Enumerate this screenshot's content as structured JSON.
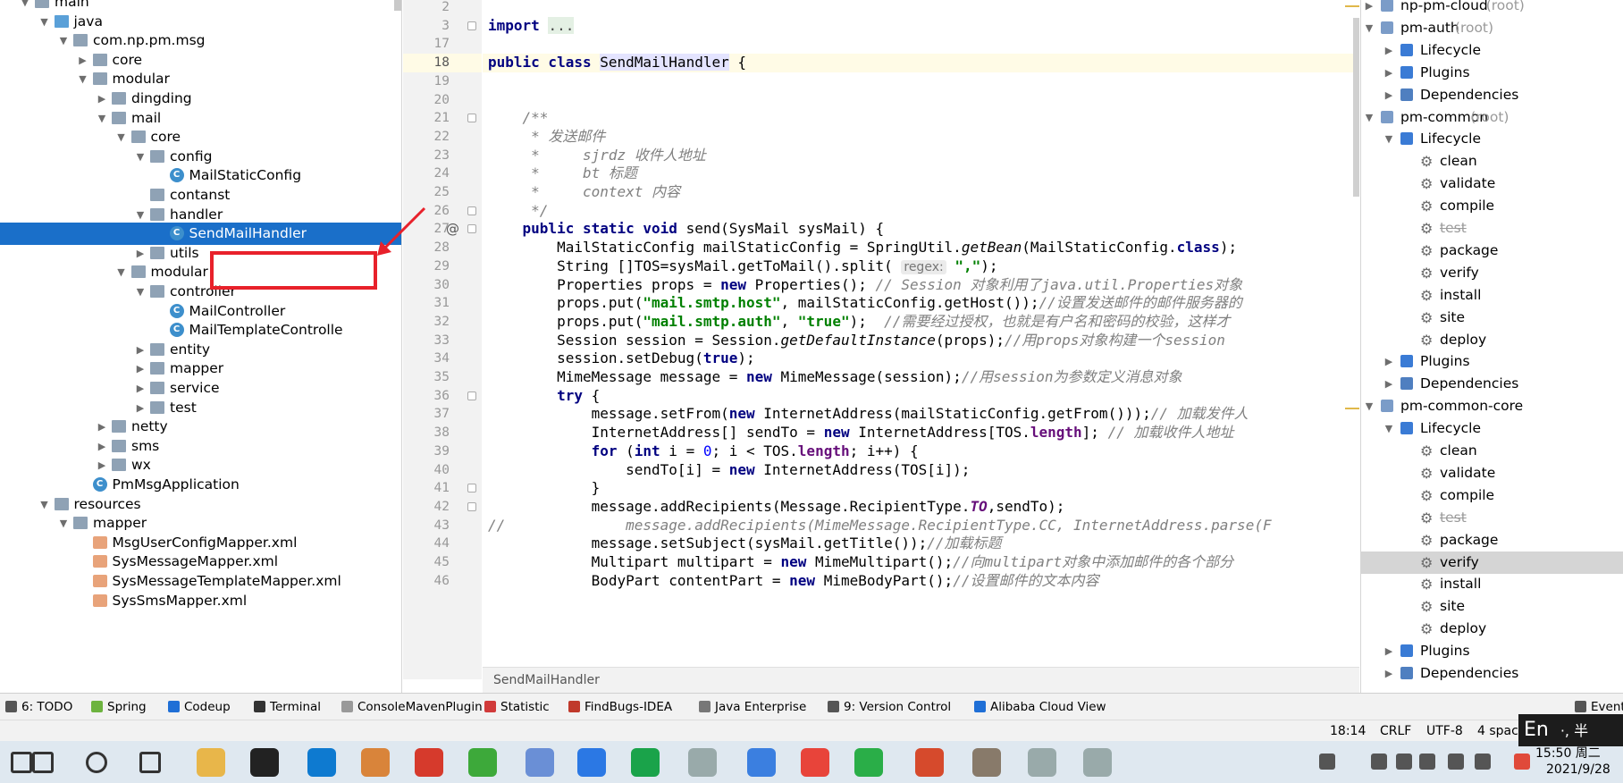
{
  "project_tree": [
    {
      "label": "main",
      "depth": 2,
      "icon": "folder",
      "arrow": "down",
      "partial": true
    },
    {
      "label": "java",
      "depth": 3,
      "icon": "folder-java",
      "arrow": "down"
    },
    {
      "label": "com.np.pm.msg",
      "depth": 4,
      "icon": "folder",
      "arrow": "down"
    },
    {
      "label": "core",
      "depth": 5,
      "icon": "folder",
      "arrow": "right"
    },
    {
      "label": "modular",
      "depth": 5,
      "icon": "folder",
      "arrow": "down"
    },
    {
      "label": "dingding",
      "depth": 6,
      "icon": "folder",
      "arrow": "right"
    },
    {
      "label": "mail",
      "depth": 6,
      "icon": "folder",
      "arrow": "down"
    },
    {
      "label": "core",
      "depth": 7,
      "icon": "folder",
      "arrow": "down"
    },
    {
      "label": "config",
      "depth": 8,
      "icon": "folder",
      "arrow": "down"
    },
    {
      "label": "MailStaticConfig",
      "depth": 9,
      "icon": "class",
      "arrow": ""
    },
    {
      "label": "contanst",
      "depth": 8,
      "icon": "folder",
      "arrow": ""
    },
    {
      "label": "handler",
      "depth": 8,
      "icon": "folder",
      "arrow": "down"
    },
    {
      "label": "SendMailHandler",
      "depth": 9,
      "icon": "class",
      "arrow": "",
      "selected": true
    },
    {
      "label": "utils",
      "depth": 8,
      "icon": "folder",
      "arrow": "right"
    },
    {
      "label": "modular",
      "depth": 7,
      "icon": "folder",
      "arrow": "down"
    },
    {
      "label": "controller",
      "depth": 8,
      "icon": "folder",
      "arrow": "down"
    },
    {
      "label": "MailController",
      "depth": 9,
      "icon": "class",
      "arrow": ""
    },
    {
      "label": "MailTemplateControlle",
      "depth": 9,
      "icon": "class",
      "arrow": ""
    },
    {
      "label": "entity",
      "depth": 8,
      "icon": "folder",
      "arrow": "right"
    },
    {
      "label": "mapper",
      "depth": 8,
      "icon": "folder",
      "arrow": "right"
    },
    {
      "label": "service",
      "depth": 8,
      "icon": "folder",
      "arrow": "right"
    },
    {
      "label": "test",
      "depth": 8,
      "icon": "folder",
      "arrow": "right"
    },
    {
      "label": "netty",
      "depth": 6,
      "icon": "folder",
      "arrow": "right"
    },
    {
      "label": "sms",
      "depth": 6,
      "icon": "folder",
      "arrow": "right"
    },
    {
      "label": "wx",
      "depth": 6,
      "icon": "folder",
      "arrow": "right"
    },
    {
      "label": "PmMsgApplication",
      "depth": 5,
      "icon": "class",
      "arrow": ""
    },
    {
      "label": "resources",
      "depth": 3,
      "icon": "folder-res",
      "arrow": "down"
    },
    {
      "label": "mapper",
      "depth": 4,
      "icon": "folder",
      "arrow": "down"
    },
    {
      "label": "MsgUserConfigMapper.xml",
      "depth": 5,
      "icon": "xml",
      "arrow": ""
    },
    {
      "label": "SysMessageMapper.xml",
      "depth": 5,
      "icon": "xml",
      "arrow": ""
    },
    {
      "label": "SysMessageTemplateMapper.xml",
      "depth": 5,
      "icon": "xml",
      "arrow": ""
    },
    {
      "label": "SysSmsMapper.xml",
      "depth": 5,
      "icon": "xml",
      "arrow": "",
      "partial": true
    }
  ],
  "editor": {
    "line_numbers": [
      "2",
      "3",
      "17",
      "18",
      "19",
      "20",
      "21",
      "22",
      "23",
      "24",
      "25",
      "26",
      "27",
      "28",
      "29",
      "30",
      "31",
      "32",
      "33",
      "34",
      "35",
      "36",
      "37",
      "38",
      "39",
      "40",
      "41",
      "42",
      "43",
      "44",
      "45",
      "46"
    ],
    "current_line": "18",
    "breadcrumb": "SendMailHandler",
    "at_marker": "@",
    "lines": [
      [],
      [
        [
          "import ",
          "kw"
        ],
        [
          "...",
          "fold"
        ]
      ],
      [],
      [
        [
          "public class ",
          "kw"
        ],
        [
          "SendMailHandler",
          "hlname"
        ],
        [
          " {",
          ""
        ]
      ],
      [],
      [],
      [
        [
          "    /**",
          "cmt"
        ]
      ],
      [
        [
          "     * 发送邮件",
          "cmt"
        ]
      ],
      [
        [
          "     *     sjrdz 收件人地址",
          "cmt"
        ]
      ],
      [
        [
          "     *     bt 标题",
          "cmt"
        ]
      ],
      [
        [
          "     *     context 内容",
          "cmt"
        ]
      ],
      [
        [
          "     */",
          "cmt"
        ]
      ],
      [
        [
          "    ",
          ""
        ],
        [
          "public static void ",
          "kw"
        ],
        [
          "send(SysMail sysMail) {",
          ""
        ]
      ],
      [
        [
          "        MailStaticConfig mailStaticConfig = SpringUtil.",
          ""
        ],
        [
          "getBean",
          "fn"
        ],
        [
          "(MailStaticConfig.",
          ""
        ],
        [
          "class",
          "kw"
        ],
        [
          ");",
          ""
        ]
      ],
      [
        [
          "        String []TOS=sysMail.getToMail().split( ",
          ""
        ],
        [
          "regex:",
          "hint"
        ],
        [
          " ",
          ""
        ],
        [
          "\",\"",
          "str"
        ],
        [
          ");",
          ""
        ]
      ],
      [
        [
          "        Properties props = ",
          ""
        ],
        [
          "new ",
          "kw"
        ],
        [
          "Properties(); ",
          ""
        ],
        [
          "// Session 对象利用了java.util.Properties对象",
          "cmt"
        ]
      ],
      [
        [
          "        props.put(",
          ""
        ],
        [
          "\"mail.smtp.host\"",
          "str"
        ],
        [
          ", mailStaticConfig.getHost());",
          ""
        ],
        [
          "//设置发送邮件的邮件服务器的",
          "cmt"
        ]
      ],
      [
        [
          "        props.put(",
          ""
        ],
        [
          "\"mail.smtp.auth\"",
          "str"
        ],
        [
          ", ",
          ""
        ],
        [
          "\"true\"",
          "str"
        ],
        [
          ");  ",
          ""
        ],
        [
          "//需要经过授权，也就是有户名和密码的校验，这样才",
          "cmt"
        ]
      ],
      [
        [
          "        Session session = Session.",
          ""
        ],
        [
          "getDefaultInstance",
          "fn"
        ],
        [
          "(props);",
          ""
        ],
        [
          "//用props对象构建一个session",
          "cmt"
        ]
      ],
      [
        [
          "        session.setDebug(",
          ""
        ],
        [
          "true",
          "kw"
        ],
        [
          ");",
          ""
        ]
      ],
      [
        [
          "        MimeMessage message = ",
          ""
        ],
        [
          "new ",
          "kw"
        ],
        [
          "MimeMessage(session);",
          ""
        ],
        [
          "//用session为参数定义消息对象",
          "cmt"
        ]
      ],
      [
        [
          "        ",
          ""
        ],
        [
          "try ",
          "kw"
        ],
        [
          "{",
          ""
        ]
      ],
      [
        [
          "            message.setFrom(",
          ""
        ],
        [
          "new ",
          "kw"
        ],
        [
          "InternetAddress(mailStaticConfig.getFrom()));",
          ""
        ],
        [
          "// 加载发件人",
          "cmt"
        ]
      ],
      [
        [
          "            InternetAddress[] sendTo = ",
          ""
        ],
        [
          "new ",
          "kw"
        ],
        [
          "InternetAddress[TOS.",
          ""
        ],
        [
          "length",
          "fld"
        ],
        [
          "]; ",
          ""
        ],
        [
          "// 加载收件人地址",
          "cmt"
        ]
      ],
      [
        [
          "            ",
          ""
        ],
        [
          "for ",
          "kw"
        ],
        [
          "(",
          ""
        ],
        [
          "int ",
          "kw"
        ],
        [
          "i = ",
          ""
        ],
        [
          "0",
          "num"
        ],
        [
          "; i < TOS.",
          ""
        ],
        [
          "length",
          "fld"
        ],
        [
          "; i++) {",
          ""
        ]
      ],
      [
        [
          "                sendTo[i] = ",
          ""
        ],
        [
          "new ",
          "kw"
        ],
        [
          "InternetAddress(TOS[i]);",
          ""
        ]
      ],
      [
        [
          "            }",
          ""
        ]
      ],
      [
        [
          "            message.addRecipients(Message.RecipientType.",
          ""
        ],
        [
          "TO",
          "fldi"
        ],
        [
          ",sendTo);",
          ""
        ]
      ],
      [
        [
          "//",
          "cmt"
        ],
        [
          "              message.addRecipients(MimeMessage.RecipientType.CC, InternetAddress.parse(F",
          "cmt"
        ]
      ],
      [
        [
          "            message.setSubject(sysMail.getTitle());",
          ""
        ],
        [
          "//加载标题",
          "cmt"
        ]
      ],
      [
        [
          "            Multipart multipart = ",
          ""
        ],
        [
          "new ",
          "kw"
        ],
        [
          "MimeMultipart();",
          ""
        ],
        [
          "//向multipart对象中添加邮件的各个部分",
          "cmt"
        ]
      ],
      [
        [
          "            BodyPart contentPart = ",
          ""
        ],
        [
          "new ",
          "kw"
        ],
        [
          "MimeBodyPart();",
          ""
        ],
        [
          "//设置邮件的文本内容",
          "cmt"
        ]
      ]
    ]
  },
  "maven_tree": [
    {
      "label": "np-pm-cloud",
      "suffix": " (root)",
      "depth": 0,
      "icon": "mvn",
      "arrow": "right",
      "partial": true
    },
    {
      "label": "pm-auth",
      "suffix": " (root)",
      "depth": 0,
      "icon": "mvn",
      "arrow": "down"
    },
    {
      "label": "Lifecycle",
      "depth": 1,
      "icon": "lc",
      "arrow": "right"
    },
    {
      "label": "Plugins",
      "depth": 1,
      "icon": "lc",
      "arrow": "right"
    },
    {
      "label": "Dependencies",
      "depth": 1,
      "icon": "dep",
      "arrow": "right"
    },
    {
      "label": "pm-common",
      "suffix": " (root)",
      "depth": 0,
      "icon": "mvn",
      "arrow": "down"
    },
    {
      "label": "Lifecycle",
      "depth": 1,
      "icon": "lc",
      "arrow": "down"
    },
    {
      "label": "clean",
      "depth": 2,
      "icon": "gear",
      "arrow": ""
    },
    {
      "label": "validate",
      "depth": 2,
      "icon": "gear",
      "arrow": ""
    },
    {
      "label": "compile",
      "depth": 2,
      "icon": "gear",
      "arrow": ""
    },
    {
      "label": "test",
      "depth": 2,
      "icon": "gear",
      "arrow": "",
      "strike": true
    },
    {
      "label": "package",
      "depth": 2,
      "icon": "gear",
      "arrow": ""
    },
    {
      "label": "verify",
      "depth": 2,
      "icon": "gear",
      "arrow": ""
    },
    {
      "label": "install",
      "depth": 2,
      "icon": "gear",
      "arrow": ""
    },
    {
      "label": "site",
      "depth": 2,
      "icon": "gear",
      "arrow": ""
    },
    {
      "label": "deploy",
      "depth": 2,
      "icon": "gear",
      "arrow": ""
    },
    {
      "label": "Plugins",
      "depth": 1,
      "icon": "lc",
      "arrow": "right"
    },
    {
      "label": "Dependencies",
      "depth": 1,
      "icon": "dep",
      "arrow": "right"
    },
    {
      "label": "pm-common-core",
      "depth": 0,
      "icon": "mvn",
      "arrow": "down"
    },
    {
      "label": "Lifecycle",
      "depth": 1,
      "icon": "lc",
      "arrow": "down"
    },
    {
      "label": "clean",
      "depth": 2,
      "icon": "gear",
      "arrow": ""
    },
    {
      "label": "validate",
      "depth": 2,
      "icon": "gear",
      "arrow": ""
    },
    {
      "label": "compile",
      "depth": 2,
      "icon": "gear",
      "arrow": ""
    },
    {
      "label": "test",
      "depth": 2,
      "icon": "gear",
      "arrow": "",
      "strike": true
    },
    {
      "label": "package",
      "depth": 2,
      "icon": "gear",
      "arrow": ""
    },
    {
      "label": "verify",
      "depth": 2,
      "icon": "gear",
      "arrow": "",
      "selected": true
    },
    {
      "label": "install",
      "depth": 2,
      "icon": "gear",
      "arrow": ""
    },
    {
      "label": "site",
      "depth": 2,
      "icon": "gear",
      "arrow": ""
    },
    {
      "label": "deploy",
      "depth": 2,
      "icon": "gear",
      "arrow": ""
    },
    {
      "label": "Plugins",
      "depth": 1,
      "icon": "lc",
      "arrow": "right"
    },
    {
      "label": "Dependencies",
      "depth": 1,
      "icon": "dep",
      "arrow": "right"
    }
  ],
  "tool_windows": [
    {
      "name": "todo",
      "label": "6: TODO",
      "icon": "list-icon",
      "color": "#555555"
    },
    {
      "name": "spring",
      "label": "Spring",
      "icon": "spring-icon",
      "color": "#6db33f"
    },
    {
      "name": "codeup",
      "label": "Codeup",
      "icon": "codeup-icon",
      "color": "#1f6fd6"
    },
    {
      "name": "terminal",
      "label": "Terminal",
      "icon": "terminal-icon",
      "color": "#333333"
    },
    {
      "name": "consolemaven",
      "label": "ConsoleMavenPlugin",
      "icon": "console-icon",
      "color": "#999999"
    },
    {
      "name": "statistic",
      "label": "Statistic",
      "icon": "statistic-icon",
      "color": "#d13a3a"
    },
    {
      "name": "findbugs",
      "label": "FindBugs-IDEA",
      "icon": "bug-icon",
      "color": "#c0392b"
    },
    {
      "name": "javaent",
      "label": "Java Enterprise",
      "icon": "enterprise-icon",
      "color": "#777777"
    },
    {
      "name": "vcs",
      "label": "9: Version Control",
      "icon": "vcs-icon",
      "color": "#555555"
    },
    {
      "name": "alibaba",
      "label": "Alibaba Cloud View",
      "icon": "cloud-icon",
      "color": "#1f6fd6"
    },
    {
      "name": "event",
      "label": "Event",
      "icon": "event-icon",
      "color": "#555555"
    }
  ],
  "status_bar": {
    "position": "18:14",
    "line_sep": "CRLF",
    "encoding": "UTF-8",
    "indent": "4 spac"
  },
  "ime": {
    "label": "En",
    "extra": "·, 半"
  },
  "taskbar": {
    "time": "15:50 周二",
    "date": "2021/9/28",
    "apps": [
      "windows-icon",
      "search-icon",
      "cortana-icon",
      "taskview-icon",
      "explorer-icon",
      "intellij-icon",
      "vscode-icon",
      "browser-icon",
      "git-icon",
      "ie-icon",
      "app-icon",
      "notes-icon",
      "hbuilder-icon",
      "chat-icon",
      "qq-icon",
      "chrome-icon",
      "wechat-icon",
      "netease-icon",
      "avatar-icon",
      "chat2-icon",
      "chat3-icon"
    ],
    "tray": [
      "up-arrow-icon",
      "network-icon",
      "volume-icon",
      "app-tray-icon",
      "battery-icon",
      "ime-icon",
      "notification-icon"
    ]
  },
  "colors": {
    "selection": "#1a6fc9",
    "annotation": "#e8212b",
    "keyword": "#000080",
    "string": "#008000"
  }
}
